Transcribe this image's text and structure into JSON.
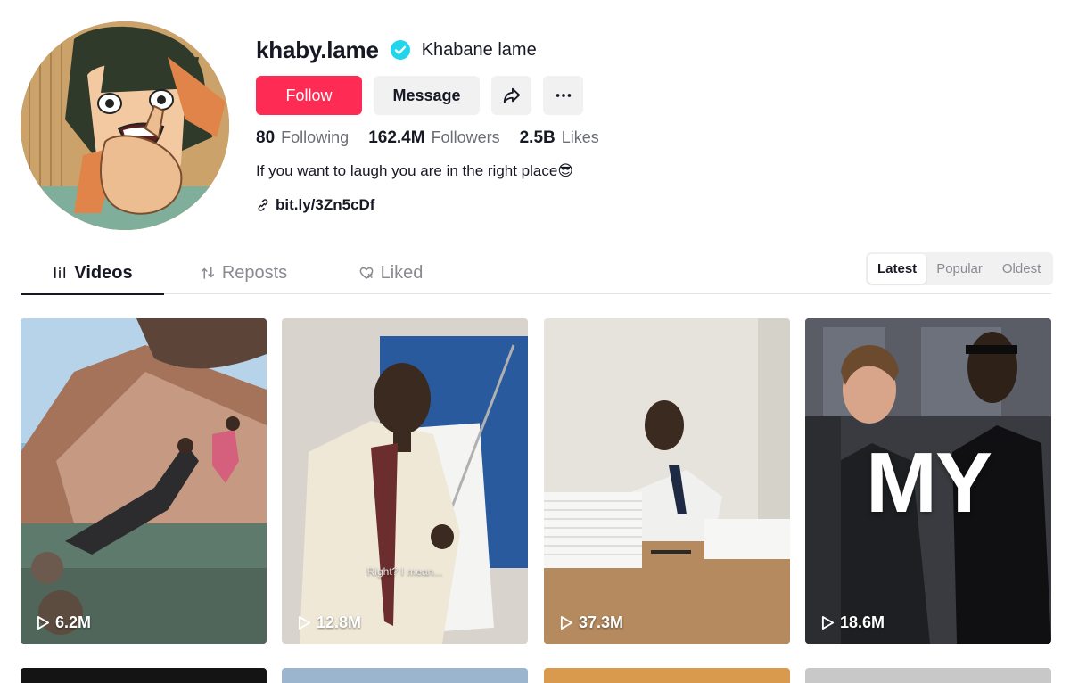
{
  "profile": {
    "username": "khaby.lame",
    "nickname": "Khabane lame",
    "verified": true,
    "bio": "If you want to laugh you are in the right place😎",
    "link": "bit.ly/3Zn5cDf"
  },
  "actions": {
    "follow_label": "Follow",
    "message_label": "Message",
    "share_icon": "share-icon",
    "more_icon": "more-icon"
  },
  "stats": [
    {
      "value": "80",
      "label": "Following"
    },
    {
      "value": "162.4M",
      "label": "Followers"
    },
    {
      "value": "2.5B",
      "label": "Likes"
    }
  ],
  "tabs": [
    {
      "label": "Videos",
      "icon": "grid-icon",
      "active": true
    },
    {
      "label": "Reposts",
      "icon": "repost-icon",
      "active": false
    },
    {
      "label": "Liked",
      "icon": "heart-icon",
      "active": false
    }
  ],
  "sort": {
    "options": [
      "Latest",
      "Popular",
      "Oldest"
    ],
    "selected": "Latest"
  },
  "videos": [
    {
      "views": "6.2M",
      "overlay_text": ""
    },
    {
      "views": "12.8M",
      "overlay_text": "Right? I mean..."
    },
    {
      "views": "37.3M",
      "overlay_text": ""
    },
    {
      "views": "18.6M",
      "overlay_text": "MY"
    }
  ],
  "colors": {
    "accent": "#fe2c55",
    "verified": "#20d5ec",
    "text_primary": "#161823",
    "text_secondary": "#6b6d75",
    "button_gray": "#f1f1f2"
  }
}
